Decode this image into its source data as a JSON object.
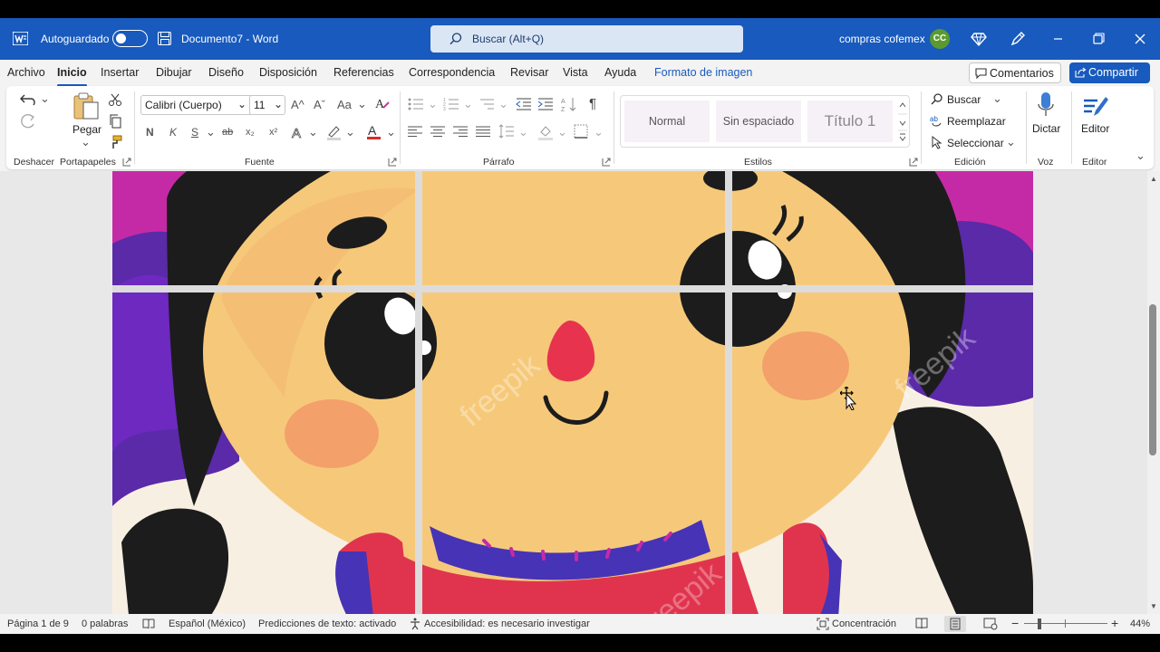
{
  "titlebar": {
    "autosave_label": "Autoguardado",
    "document_title": "Documento7",
    "separator": "-",
    "app_name": "Word",
    "search_placeholder": "Buscar (Alt+Q)",
    "account_name": "compras cofemex",
    "avatar_initials": "CC",
    "brand_color": "#185abd"
  },
  "tabs": [
    {
      "label": "Archivo"
    },
    {
      "label": "Inicio",
      "active": true
    },
    {
      "label": "Insertar"
    },
    {
      "label": "Dibujar"
    },
    {
      "label": "Diseño"
    },
    {
      "label": "Disposición"
    },
    {
      "label": "Referencias"
    },
    {
      "label": "Correspondencia"
    },
    {
      "label": "Revisar"
    },
    {
      "label": "Vista"
    },
    {
      "label": "Ayuda"
    },
    {
      "label": "Formato de imagen",
      "contextual": true
    }
  ],
  "actions": {
    "comments_label": "Comentarios",
    "share_label": "Compartir"
  },
  "ribbon": {
    "groups": {
      "undo": "Deshacer",
      "clipboard": "Portapapeles",
      "font": "Fuente",
      "paragraph": "Párrafo",
      "styles": "Estilos",
      "editing": "Edición",
      "voice": "Voz",
      "editor": "Editor"
    },
    "paste_label": "Pegar",
    "font_name": "Calibri (Cuerpo)",
    "font_size": "11",
    "bold": "N",
    "italic": "K",
    "underline": "S",
    "strikethrough": "ab",
    "subscript": "x₂",
    "superscript": "x²",
    "grow_font": "A^",
    "shrink_font": "Aˇ",
    "change_case": "Aa",
    "styles": [
      "Normal",
      "Sin espaciado",
      "Título 1"
    ],
    "find_label": "Buscar",
    "replace_label": "Reemplazar",
    "select_label": "Seleccionar",
    "dictate_label": "Dictar",
    "editor_label": "Editor"
  },
  "statusbar": {
    "page": "Página 1 de 9",
    "words": "0 palabras",
    "language": "Español (México)",
    "predictions": "Predicciones de texto: activado",
    "accessibility": "Accesibilidad: es necesario investigar",
    "focus": "Concentración",
    "zoom": "44%",
    "zoom_level": 0.44
  },
  "image": {
    "description_icon": "doll-face-image",
    "watermark": "freepik",
    "colors": {
      "skin": "#f6c97a",
      "hair": "#1c1c1c",
      "ribbon_purple": "#5a2aa8",
      "ribbon_magenta": "#c52aa6",
      "cheek": "#f3a06a",
      "nose": "#e8334f",
      "dress_red": "#e0344e",
      "collar_blue": "#4733b5"
    }
  }
}
